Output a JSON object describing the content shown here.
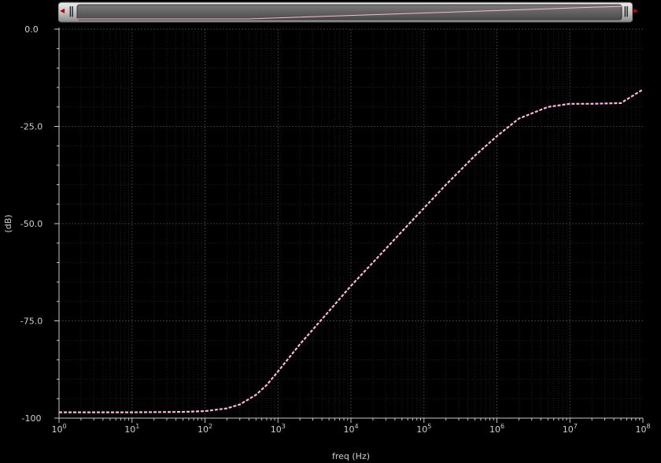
{
  "chart_data": {
    "type": "line",
    "title": "",
    "xlabel": "freq (Hz)",
    "ylabel": "(dB)",
    "xscale": "log",
    "xlim": [
      1,
      100000000
    ],
    "ylim": [
      -100,
      0
    ],
    "grid": true,
    "x_tick_exponents": [
      "0",
      "1",
      "2",
      "3",
      "4",
      "5",
      "6",
      "7",
      "8"
    ],
    "x_tick_base": "10",
    "y_ticks": [
      "0.0",
      "-25.0",
      "-50.0",
      "-75.0",
      "-100"
    ],
    "y_tick_values": [
      0,
      -25,
      -50,
      -75,
      -100
    ],
    "series": [
      {
        "color": "#ffb6dc",
        "style": "dashed",
        "x": [
          1,
          10,
          50,
          100,
          200,
          300,
          500,
          700,
          1000,
          2000,
          5000,
          10000,
          20000,
          50000,
          100000,
          200000,
          500000,
          1000000,
          2000000,
          5000000,
          10000000,
          20000000,
          50000000,
          100000000
        ],
        "y": [
          -98.5,
          -98.5,
          -98.4,
          -98.2,
          -97.5,
          -96.5,
          -94,
          -91.5,
          -88,
          -81,
          -72.5,
          -66,
          -60,
          -52,
          -46,
          -40,
          -32.5,
          -27.5,
          -23,
          -20,
          -19.2,
          -19.2,
          -19,
          -15.5
        ]
      }
    ]
  },
  "toolbar": {
    "left_arrow": "◀",
    "right_arrow": "▶",
    "left_handle": "||",
    "right_handle": "||"
  }
}
